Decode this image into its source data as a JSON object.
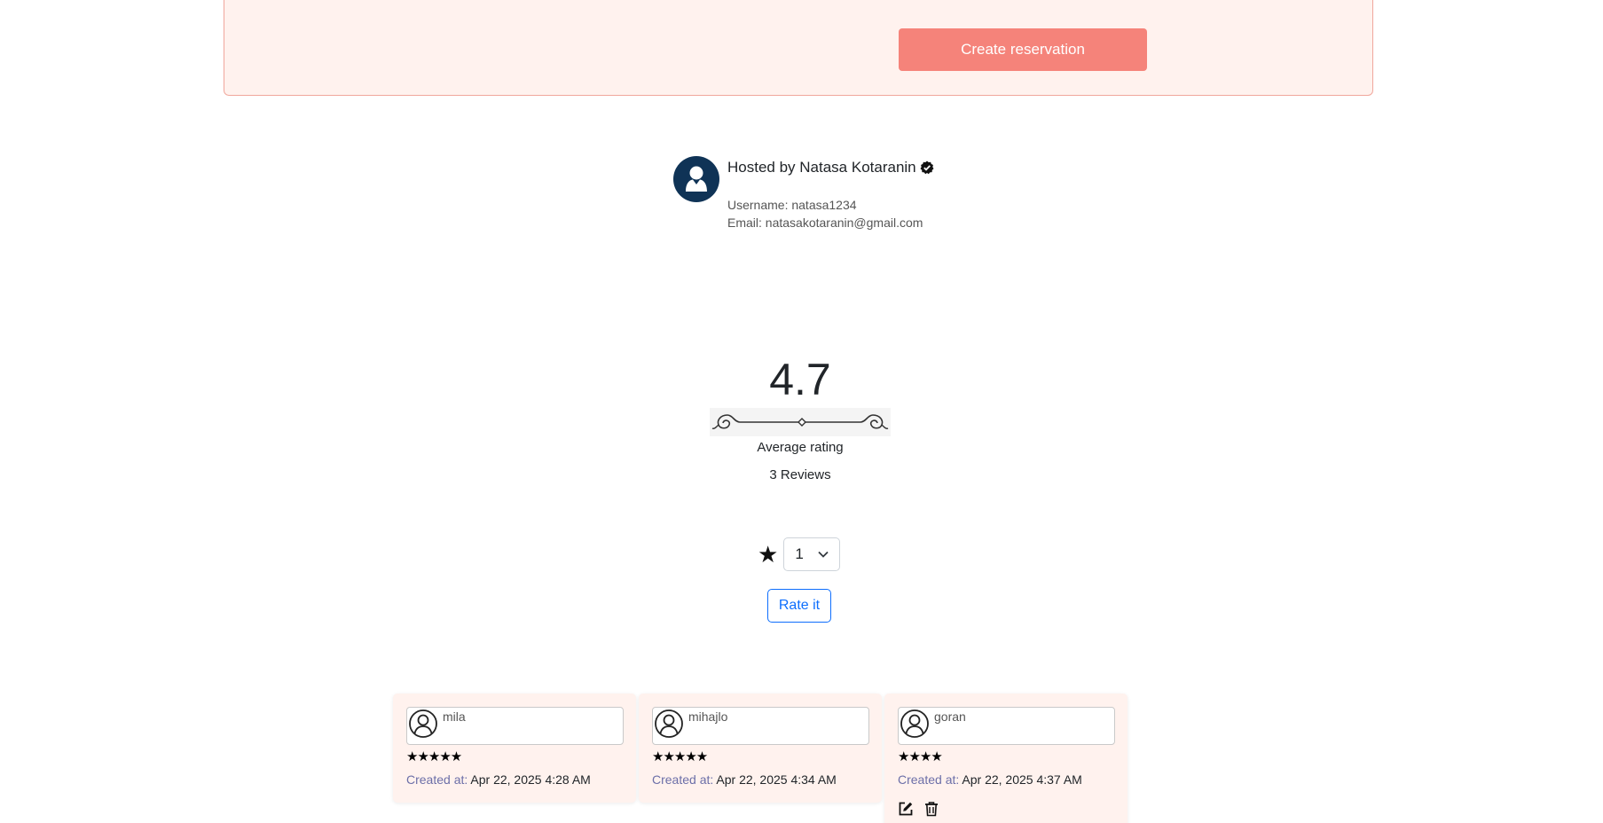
{
  "reservation": {
    "button_label": "Create reservation"
  },
  "host": {
    "title": "Hosted by Natasa Kotaranin",
    "username": "Username: natasa1234",
    "email": "Email: natasakotaranin@gmail.com"
  },
  "rating": {
    "average": "4.7",
    "average_label": "Average rating",
    "reviews_count": "3 Reviews"
  },
  "rate_form": {
    "star_glyph": "★",
    "selected_value": "1",
    "button_label": "Rate it"
  },
  "reviews": [
    {
      "username": "mila",
      "stars": "★★★★★",
      "created_label": "Created at:",
      "created_value": "Apr 22, 2025 4:28 AM"
    },
    {
      "username": "mihajlo",
      "stars": "★★★★★",
      "created_label": "Created at:",
      "created_value": "Apr 22, 2025 4:34 AM"
    },
    {
      "username": "goran",
      "stars": "★★★★",
      "created_label": "Created at:",
      "created_value": "Apr 22, 2025 4:37 AM"
    }
  ],
  "colors": {
    "accent_button": "#f5837a",
    "panel_background": "#fff2ee",
    "host_avatar": "#0f3356",
    "primary_outline": "#0d6efd"
  },
  "icons": {
    "host_avatar": "user-avatar-icon",
    "verified": "verified-badge-icon",
    "review_avatar": "user-circle-icon",
    "edit": "edit-icon",
    "delete": "trash-icon",
    "select_arrow": "chevron-down-icon"
  }
}
